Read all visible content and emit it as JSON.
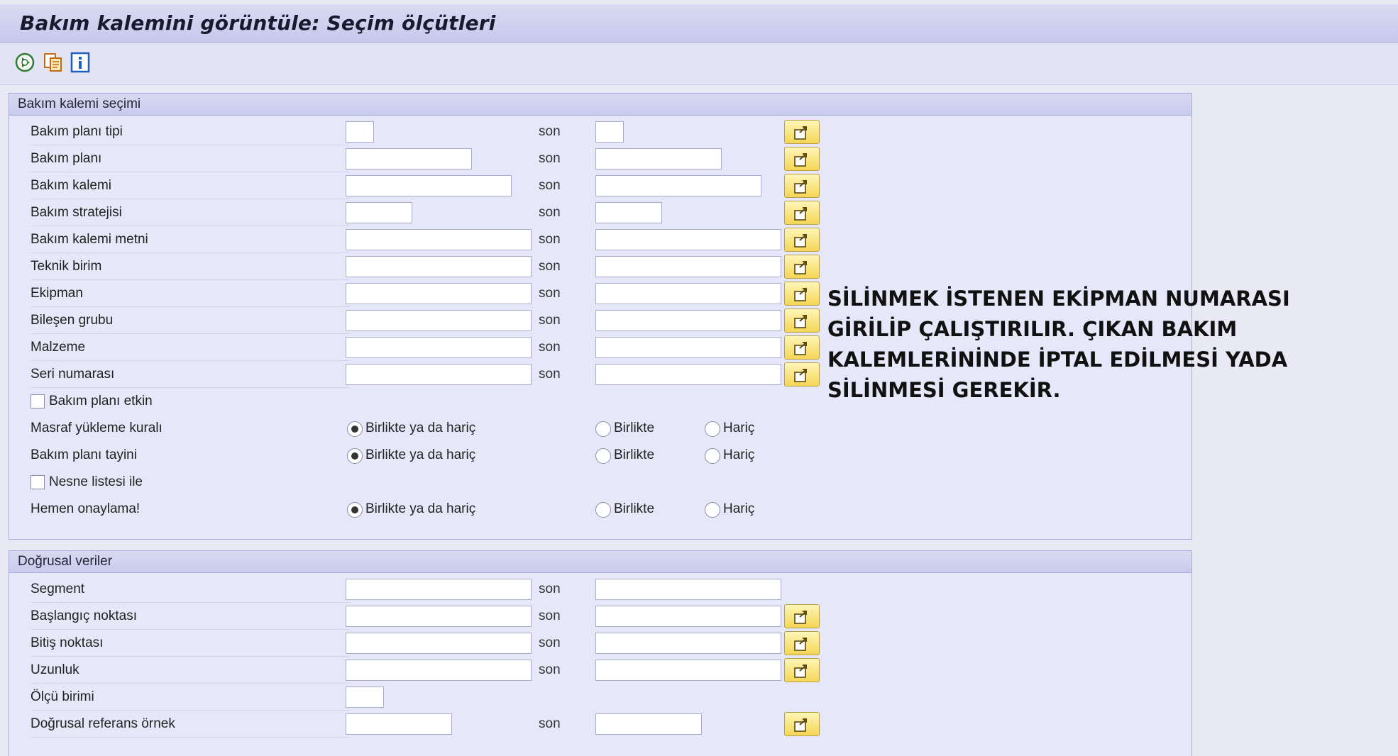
{
  "window": {
    "title": "Bakım kalemini görüntüle: Seçim ölçütleri"
  },
  "toolbar": {
    "icons": [
      "execute-icon",
      "copy-variant-icon",
      "info-icon"
    ]
  },
  "selection_group": {
    "header": "Bakım kalemi seçimi",
    "son_label": "son",
    "fields": [
      {
        "label": "Bakım planı tipi"
      },
      {
        "label": "Bakım planı"
      },
      {
        "label": "Bakım kalemi"
      },
      {
        "label": "Bakım stratejisi"
      },
      {
        "label": "Bakım kalemi metni"
      },
      {
        "label": "Teknik birim"
      },
      {
        "label": "Ekipman"
      },
      {
        "label": "Bileşen grubu"
      },
      {
        "label": "Malzeme"
      },
      {
        "label": "Seri numarası"
      }
    ],
    "checkbox_active_plan": "Bakım planı etkin",
    "checkbox_object_list": "Nesne listesi ile",
    "radio_rows": [
      {
        "label": "Masraf yükleme kuralı",
        "options": [
          "Birlikte ya da hariç",
          "Birlikte",
          "Hariç"
        ],
        "selected": 0
      },
      {
        "label": "Bakım planı tayini",
        "options": [
          "Birlikte ya da hariç",
          "Birlikte",
          "Hariç"
        ],
        "selected": 0
      },
      {
        "label": "Hemen onaylama!",
        "options": [
          "Birlikte ya da hariç",
          "Birlikte",
          "Hariç"
        ],
        "selected": 0
      }
    ]
  },
  "linear_group": {
    "header": "Doğrusal veriler",
    "son_label": "son",
    "fields": [
      {
        "label": "Segment"
      },
      {
        "label": "Başlangıç noktası"
      },
      {
        "label": "Bitiş noktası"
      },
      {
        "label": "Uzunluk"
      },
      {
        "label": "Ölçü birimi"
      },
      {
        "label": "Doğrusal referans örnek"
      }
    ]
  },
  "annotation": {
    "lines": [
      "SİLİNMEK İSTENEN EKİPMAN NUMARASI",
      "GİRİLİP ÇALIŞTIRILIR. ÇIKAN BAKIM",
      "KALEMLERİNİNDE İPTAL EDİLMESİ YADA",
      "SİLİNMESİ GEREKİR."
    ]
  },
  "colors": {
    "title_bg": "#c5c8ec",
    "group_border": "#a9acd8",
    "multi_select_button": "#f4d656"
  }
}
